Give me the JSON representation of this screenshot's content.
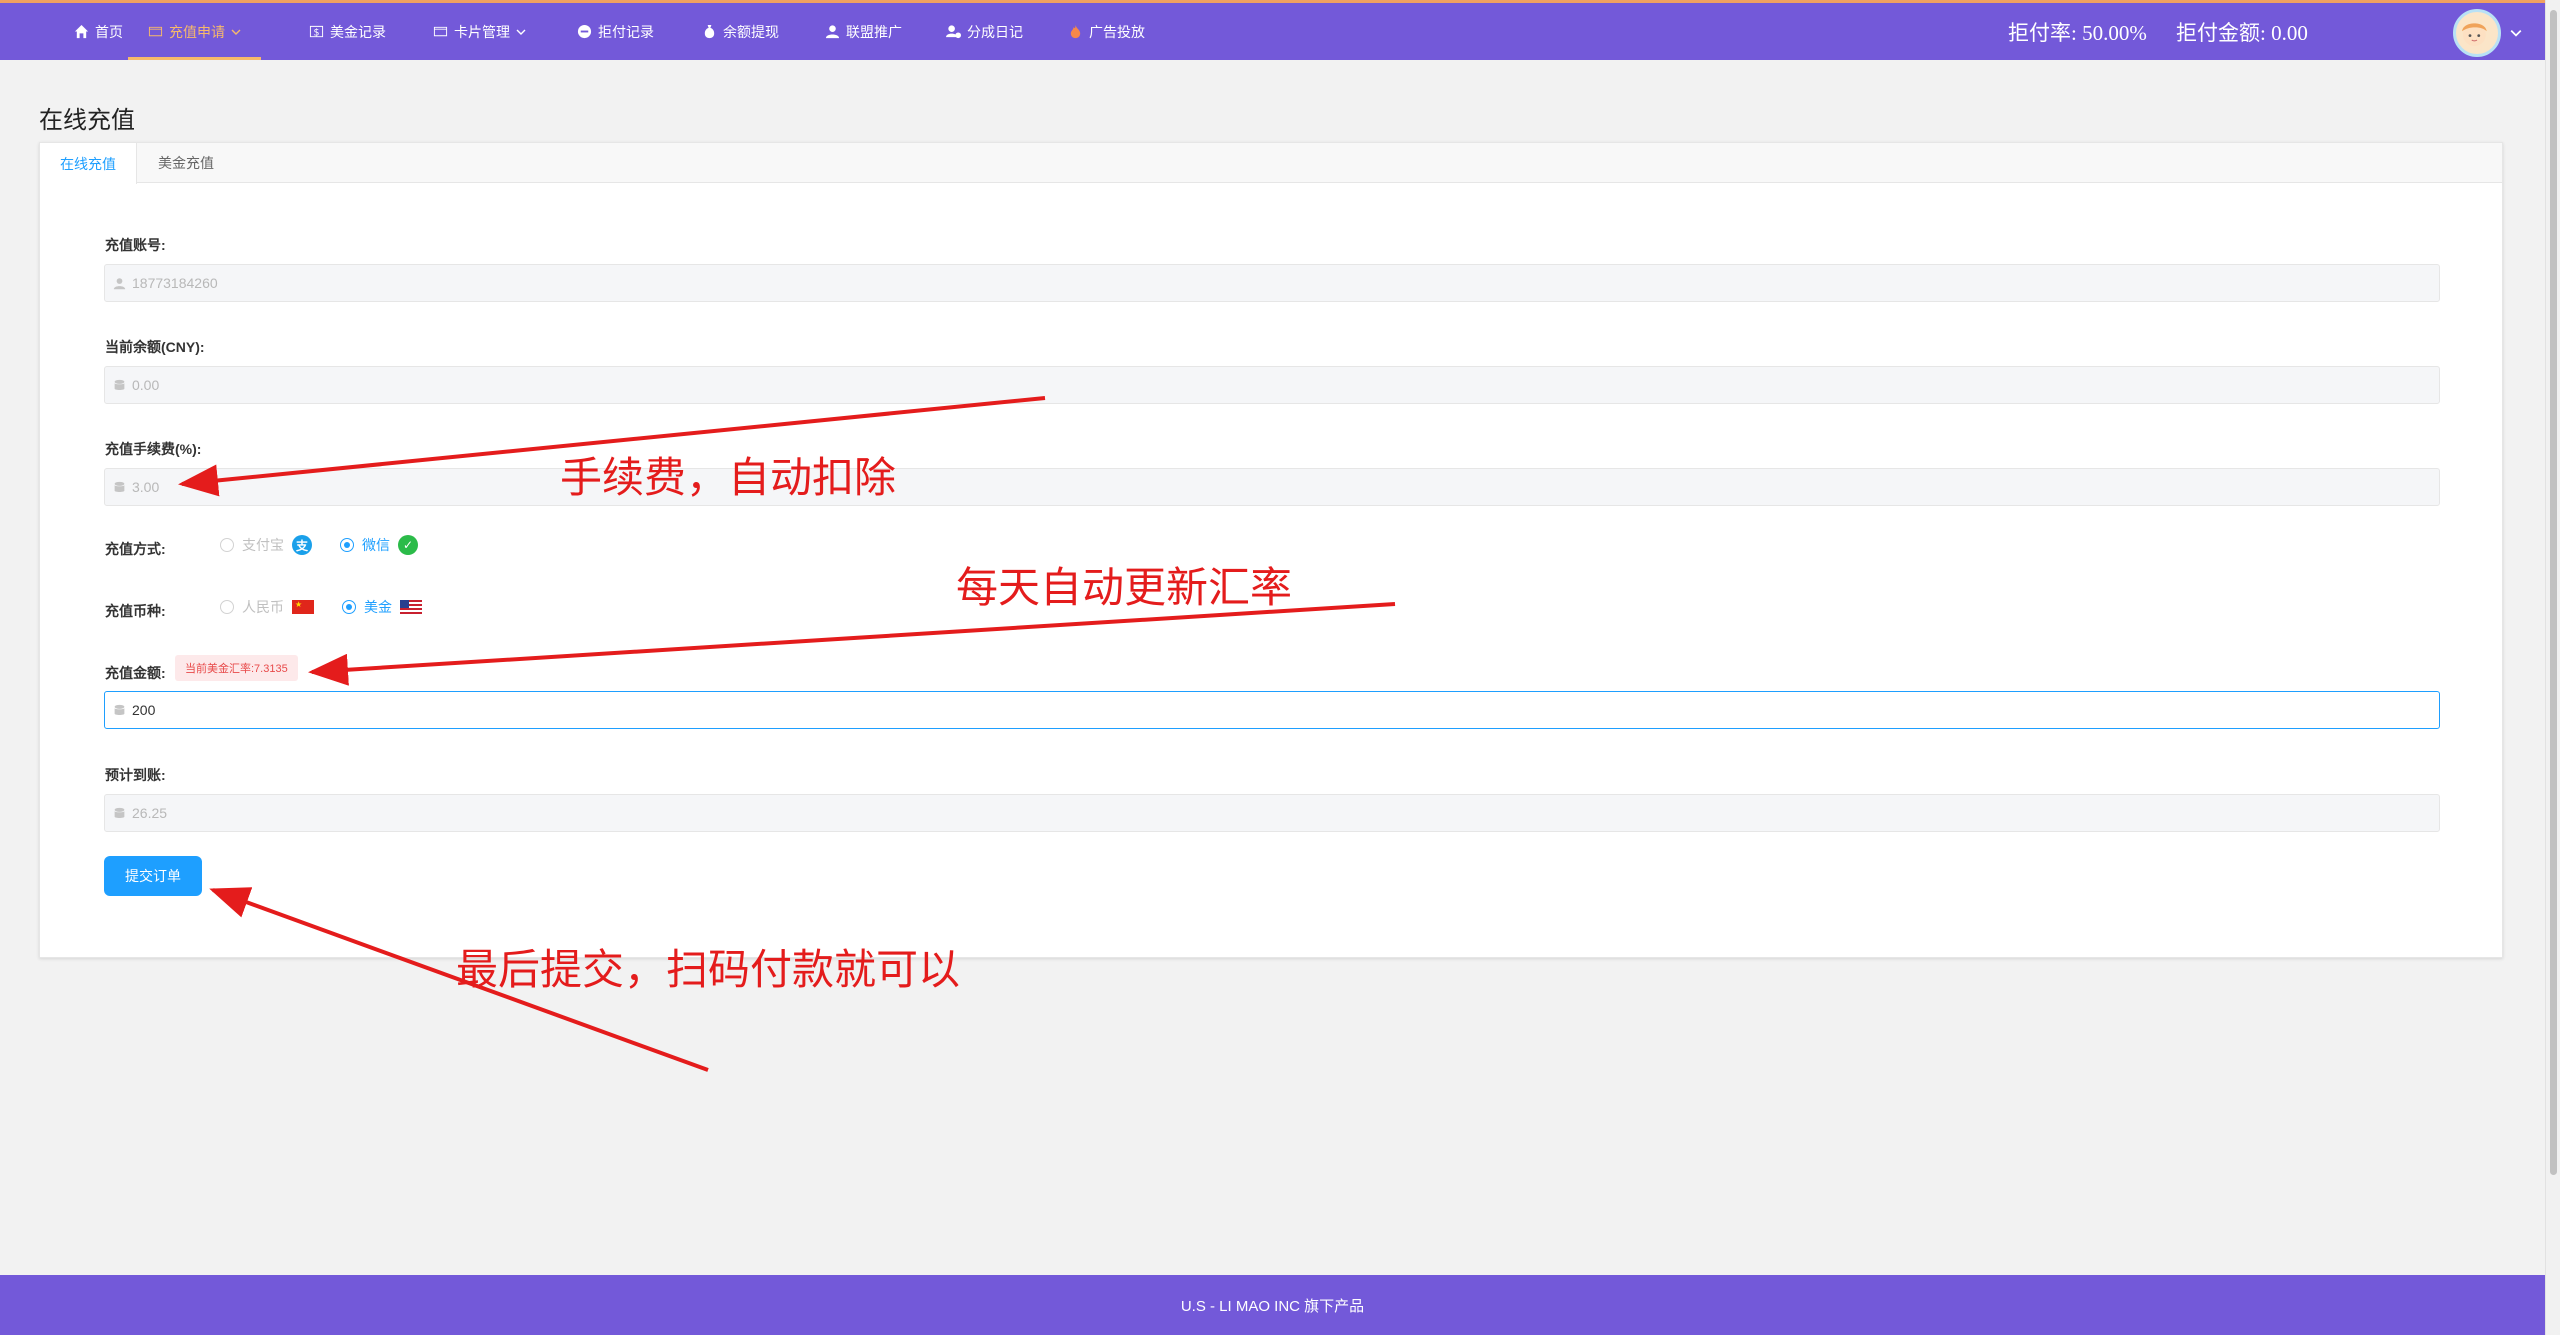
{
  "nav": {
    "items": [
      {
        "label": "首页",
        "icon": "home-icon"
      },
      {
        "label": "充值申请",
        "icon": "card-icon",
        "dropdown": true,
        "active": true
      },
      {
        "label": "美金记录",
        "icon": "dollar-icon"
      },
      {
        "label": "卡片管理",
        "icon": "card-icon",
        "dropdown": true
      },
      {
        "label": "拒付记录",
        "icon": "minus-circle-icon"
      },
      {
        "label": "余额提现",
        "icon": "money-bag-icon"
      },
      {
        "label": "联盟推广",
        "icon": "user-icon"
      },
      {
        "label": "分成日记",
        "icon": "share-icon"
      },
      {
        "label": "广告投放",
        "icon": "fire-icon"
      }
    ],
    "refusal_rate": "拒付率: 50.00%",
    "refusal_amount": "拒付金额: 0.00"
  },
  "page": {
    "title": "在线充值",
    "tabs": [
      "在线充值",
      "美金充值"
    ]
  },
  "form": {
    "account_label": "充值账号:",
    "account_value": "18773184260",
    "balance_label": "当前余额(CNY):",
    "balance_value": "0.00",
    "fee_label": "充值手续费(%):",
    "fee_value": "3.00",
    "method_label": "充值方式:",
    "method_options": [
      "支付宝",
      "微信"
    ],
    "method_selected": "微信",
    "currency_label": "充值币种:",
    "currency_options": [
      "人民币",
      "美金"
    ],
    "currency_selected": "美金",
    "amount_label": "充值金额:",
    "rate_tip": "当前美金汇率:7.3135",
    "amount_value": "200",
    "expected_label": "预计到账:",
    "expected_value": "26.25",
    "submit_label": "提交订单"
  },
  "annotations": {
    "fee_note": "手续费，自动扣除",
    "rate_note": "每天自动更新汇率",
    "submit_note": "最后提交，扫码付款就可以"
  },
  "footer": {
    "text": "U.S - LI MAO INC 旗下产品"
  },
  "colors": {
    "nav_bg": "#7359d9",
    "accent": "#1e9fff",
    "active_nav": "#f7b96b",
    "annotation": "#e41c1c"
  }
}
